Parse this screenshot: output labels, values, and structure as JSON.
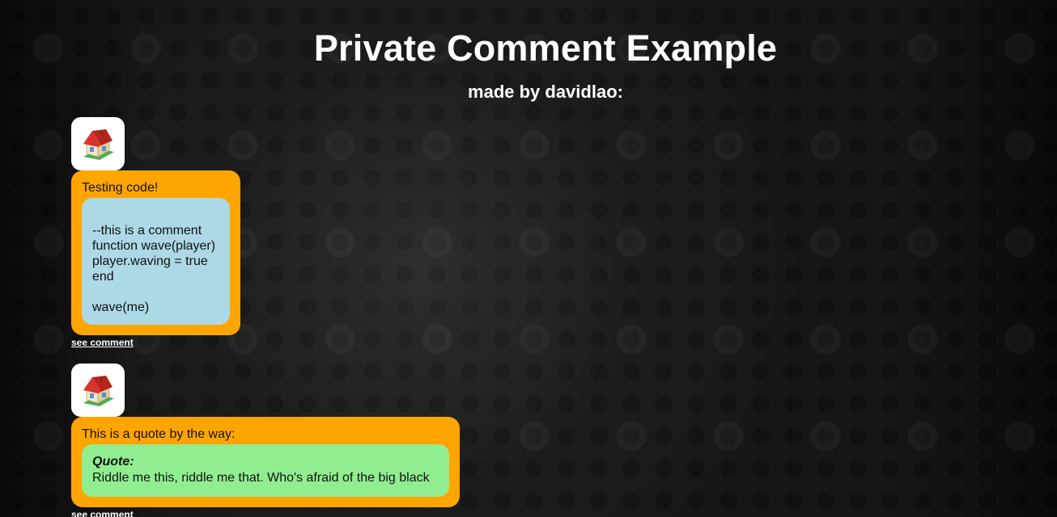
{
  "header": {
    "title": "Private Comment Example",
    "subtitle": "made by davidlao:"
  },
  "comments": [
    {
      "avatar_icon": "house-icon",
      "text": "Testing code!",
      "code_lines": [
        "",
        "--this is a comment",
        "function wave(player)",
        "player.waving = true",
        "end",
        "",
        "wave(me)"
      ],
      "link_label": "see comment"
    },
    {
      "avatar_icon": "house-icon",
      "text": "This is a quote by the way:",
      "quote_label": "Quote:",
      "quote_text": "Riddle me this, riddle me that. Who's afraid of the big black",
      "link_label": "see comment"
    }
  ],
  "colors": {
    "bubble": "#ffa500",
    "code_block": "#add8e6",
    "quote_block": "#90ee90"
  }
}
